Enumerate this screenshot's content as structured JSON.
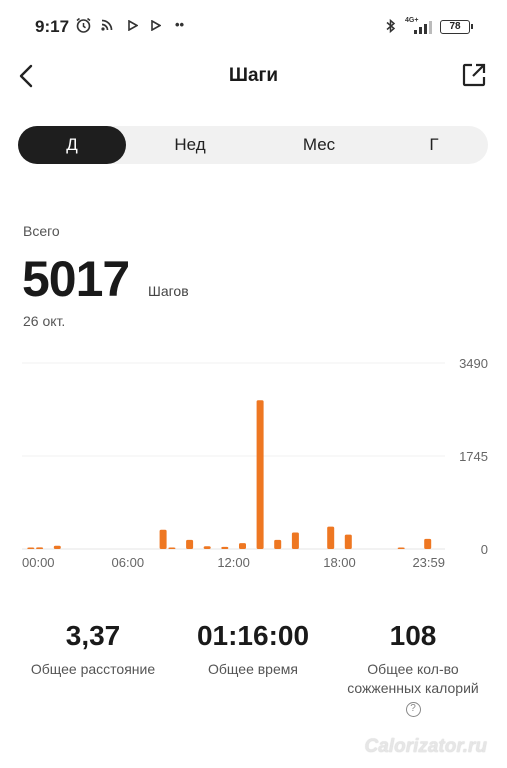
{
  "status_bar": {
    "time": "9:17",
    "network": "4G+",
    "battery": "78"
  },
  "header": {
    "title": "Шаги"
  },
  "tabs": [
    {
      "label": "Д",
      "active": true
    },
    {
      "label": "Нед",
      "active": false
    },
    {
      "label": "Мес",
      "active": false
    },
    {
      "label": "Г",
      "active": false
    }
  ],
  "summary": {
    "total_label": "Всего",
    "total_value": "5017",
    "unit": "Шагов",
    "date": "26 окт."
  },
  "chart_data": {
    "type": "bar",
    "x_ticks": [
      "00:00",
      "06:00",
      "12:00",
      "18:00",
      "23:59"
    ],
    "y_ticks": [
      "3490",
      "1745",
      "0"
    ],
    "ylim": [
      0,
      3490
    ],
    "bar_color": "#ee7722",
    "grid": true,
    "categories": [
      "00:30",
      "01:00",
      "02:00",
      "08:00",
      "08:30",
      "09:00",
      "09:30",
      "10:00",
      "10:30",
      "11:00",
      "11:30",
      "12:00",
      "12:30",
      "13:00",
      "13:30",
      "14:00",
      "14:30",
      "15:00",
      "15:30",
      "16:00",
      "16:30",
      "17:00",
      "17:30",
      "18:00",
      "18:30",
      "19:00",
      "19:30",
      "20:00",
      "20:30",
      "21:00",
      "21:30",
      "22:00",
      "22:30",
      "23:00"
    ],
    "values": [
      20,
      30,
      60,
      360,
      10,
      0,
      170,
      0,
      50,
      0,
      40,
      0,
      110,
      0,
      2790,
      0,
      170,
      0,
      310,
      0,
      0,
      0,
      420,
      0,
      270,
      0,
      0,
      0,
      0,
      0,
      20,
      0,
      0,
      190
    ]
  },
  "stats": [
    {
      "value": "3,37",
      "label": "Общее расстояние"
    },
    {
      "value": "01:16:00",
      "label": "Общее время"
    },
    {
      "value": "108",
      "label": "Общее кол-во сожженных калорий"
    }
  ],
  "watermark": "Calorizator.ru"
}
